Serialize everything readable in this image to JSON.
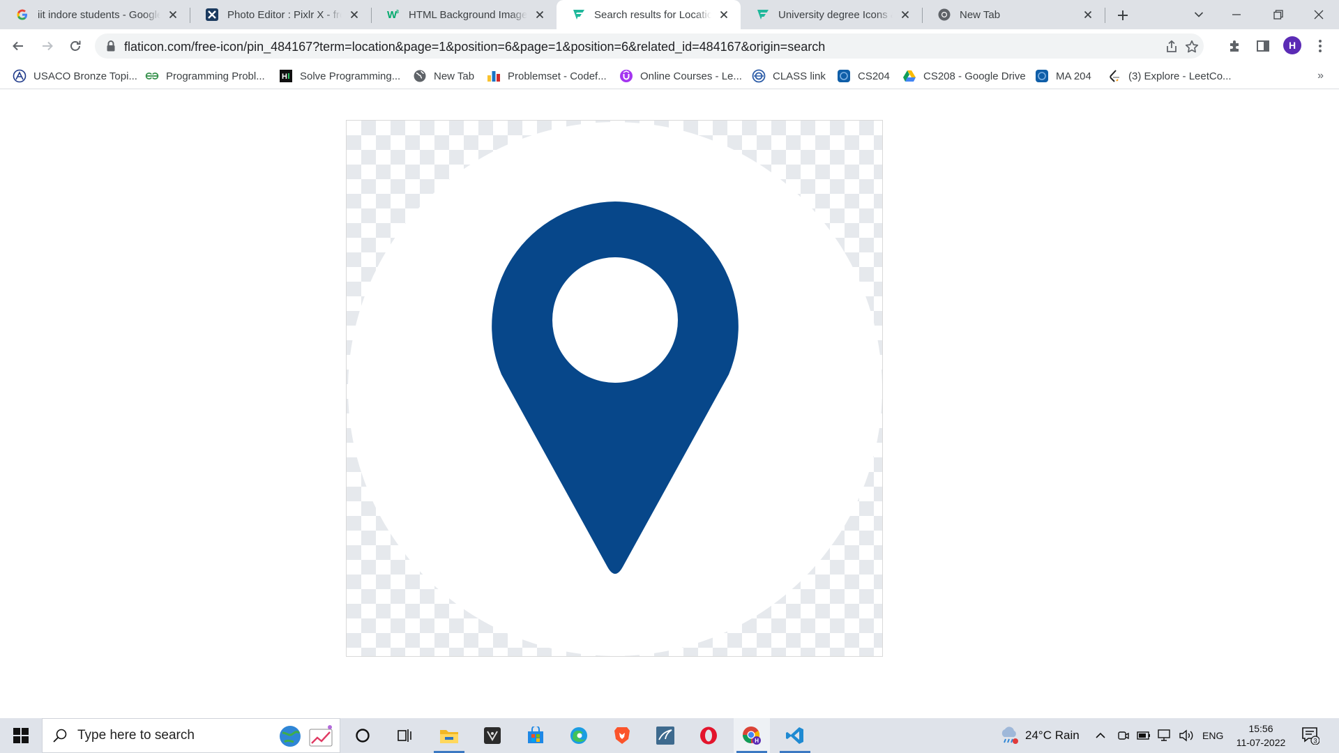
{
  "browser": {
    "tabs": [
      {
        "title": "iit indore students - Google",
        "favicon": "google-g-icon",
        "active": false
      },
      {
        "title": "Photo Editor : Pixlr X - free i",
        "favicon": "pixlr-icon",
        "active": false
      },
      {
        "title": "HTML Background Images",
        "favicon": "w3schools-icon",
        "active": false
      },
      {
        "title": "Search results for Location",
        "favicon": "flaticon-icon",
        "active": true
      },
      {
        "title": "University degree Icons & S",
        "favicon": "flaticon-icon",
        "active": false
      },
      {
        "title": "New Tab",
        "favicon": "chrome-icon",
        "active": false
      }
    ],
    "address": {
      "url": "flaticon.com/free-icon/pin_484167?term=location&page=1&position=6&page=1&position=6&related_id=484167&origin=search"
    },
    "profile_initial": "H",
    "bookmarks": [
      {
        "label": "USACO Bronze Topi...",
        "icon": "usaco-icon"
      },
      {
        "label": "Programming Probl...",
        "icon": "geeksforgeeks-icon"
      },
      {
        "label": "Solve Programming...",
        "icon": "hackerrank-icon"
      },
      {
        "label": "New Tab",
        "icon": "globe-icon"
      },
      {
        "label": "Problemset - Codef...",
        "icon": "codeforces-icon"
      },
      {
        "label": "Online Courses - Le...",
        "icon": "udemy-icon"
      },
      {
        "label": "CLASS link",
        "icon": "classlink-icon"
      },
      {
        "label": "CS204",
        "icon": "moodle-icon"
      },
      {
        "label": "CS208 - Google Drive",
        "icon": "google-drive-icon"
      },
      {
        "label": "MA 204",
        "icon": "moodle-icon"
      },
      {
        "label": "(3) Explore - LeetCo...",
        "icon": "leetcode-icon"
      }
    ],
    "bookmarks_more": "»"
  },
  "content": {
    "image": {
      "subject": "location-pin-icon",
      "pin_color": "#07478a",
      "background": "#ffffff"
    }
  },
  "taskbar": {
    "search_placeholder": "Type here to search",
    "weather": "24°C  Rain",
    "language": "ENG",
    "time": "15:56",
    "date": "11-07-2022",
    "notifications": "3",
    "apps": [
      "cortana-icon",
      "task-view-icon",
      "file-explorer-icon",
      "app-icon",
      "microsoft-store-icon",
      "edge-icon",
      "brave-icon",
      "mysql-workbench-icon",
      "opera-icon",
      "chrome-icon",
      "vscode-icon"
    ]
  }
}
